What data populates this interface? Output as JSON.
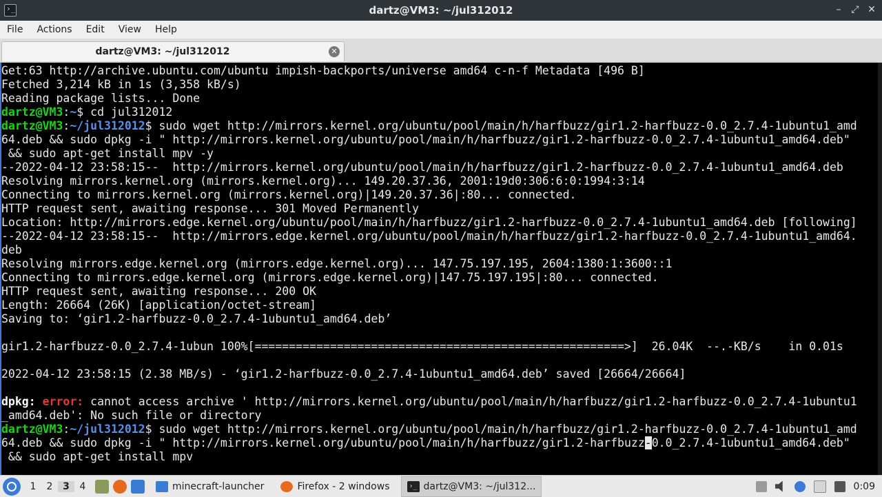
{
  "window": {
    "title": "dartz@VM3: ~/jul312012"
  },
  "menubar": {
    "items": [
      "File",
      "Actions",
      "Edit",
      "View",
      "Help"
    ]
  },
  "tab": {
    "label": "dartz@VM3: ~/jul312012"
  },
  "terminal": {
    "l1": "Get:63 http://archive.ubuntu.com/ubuntu impish-backports/universe amd64 c-n-f Metadata [496 B]",
    "l2": "Fetched 3,214 kB in 1s (3,358 kB/s)",
    "l3": "Reading package lists... Done",
    "p1_user": "dartz@VM3",
    "p1_path": "~",
    "p1_cmd": "$ cd jul312012",
    "p2_user": "dartz@VM3",
    "p2_path": "~/jul312012",
    "p2_cmd": "$ sudo wget http://mirrors.kernel.org/ubuntu/pool/main/h/harfbuzz/gir1.2-harfbuzz-0.0_2.7.4-1ubuntu1_amd",
    "l6": "64.deb && sudo dpkg -i \" http://mirrors.kernel.org/ubuntu/pool/main/h/harfbuzz/gir1.2-harfbuzz-0.0_2.7.4-1ubuntu1_amd64.deb\"",
    "l7": " && sudo apt-get install mpv -y",
    "l8": "--2022-04-12 23:58:15--  http://mirrors.kernel.org/ubuntu/pool/main/h/harfbuzz/gir1.2-harfbuzz-0.0_2.7.4-1ubuntu1_amd64.deb",
    "l9": "Resolving mirrors.kernel.org (mirrors.kernel.org)... 149.20.37.36, 2001:19d0:306:6:0:1994:3:14",
    "l10": "Connecting to mirrors.kernel.org (mirrors.kernel.org)|149.20.37.36|:80... connected.",
    "l11": "HTTP request sent, awaiting response... 301 Moved Permanently",
    "l12": "Location: http://mirrors.edge.kernel.org/ubuntu/pool/main/h/harfbuzz/gir1.2-harfbuzz-0.0_2.7.4-1ubuntu1_amd64.deb [following]",
    "l13": "--2022-04-12 23:58:15--  http://mirrors.edge.kernel.org/ubuntu/pool/main/h/harfbuzz/gir1.2-harfbuzz-0.0_2.7.4-1ubuntu1_amd64.",
    "l14": "deb",
    "l15": "Resolving mirrors.edge.kernel.org (mirrors.edge.kernel.org)... 147.75.197.195, 2604:1380:1:3600::1",
    "l16": "Connecting to mirrors.edge.kernel.org (mirrors.edge.kernel.org)|147.75.197.195|:80... connected.",
    "l17": "HTTP request sent, awaiting response... 200 OK",
    "l18": "Length: 26664 (26K) [application/octet-stream]",
    "l19": "Saving to: ‘gir1.2-harfbuzz-0.0_2.7.4-1ubuntu1_amd64.deb’",
    "l21": "gir1.2-harfbuzz-0.0_2.7.4-1ubun 100%[======================================================>]  26.04K  --.-KB/s    in 0.01s",
    "l23": "2022-04-12 23:58:15 (2.38 MB/s) - ‘gir1.2-harfbuzz-0.0_2.7.4-1ubuntu1_amd64.deb’ saved [26664/26664]",
    "e_dpkg": "dpkg:",
    "e_error": "error:",
    "e_msg": " cannot access archive ' http://mirrors.kernel.org/ubuntu/pool/main/h/harfbuzz/gir1.2-harfbuzz-0.0_2.7.4-1ubuntu1",
    "l26": "_amd64.deb': No such file or directory",
    "p3_user": "dartz@VM3",
    "p3_path": "~/jul312012",
    "p3_cmd": "$ sudo wget http://mirrors.kernel.org/ubuntu/pool/main/h/harfbuzz/gir1.2-harfbuzz-0.0_2.7.4-1ubuntu1_amd",
    "l28a": "64.deb && sudo dpkg -i \" http://mirrors.kernel.org/ubuntu/pool/main/h/harfbuzz/gir1.2-harfbuzz",
    "l28cur": "-",
    "l28b": "0.0_2.7.4-1ubuntu1_amd64.deb\"",
    "l29": " && sudo apt-get install mpv"
  },
  "taskbar": {
    "desktops": [
      "1",
      "2",
      "3",
      "4"
    ],
    "active_desktop": "3",
    "tasks": [
      {
        "label": "minecraft-launcher"
      },
      {
        "label": "Firefox - 2 windows"
      },
      {
        "label": "dartz@VM3: ~/jul312..."
      }
    ],
    "clock": "0:09"
  }
}
